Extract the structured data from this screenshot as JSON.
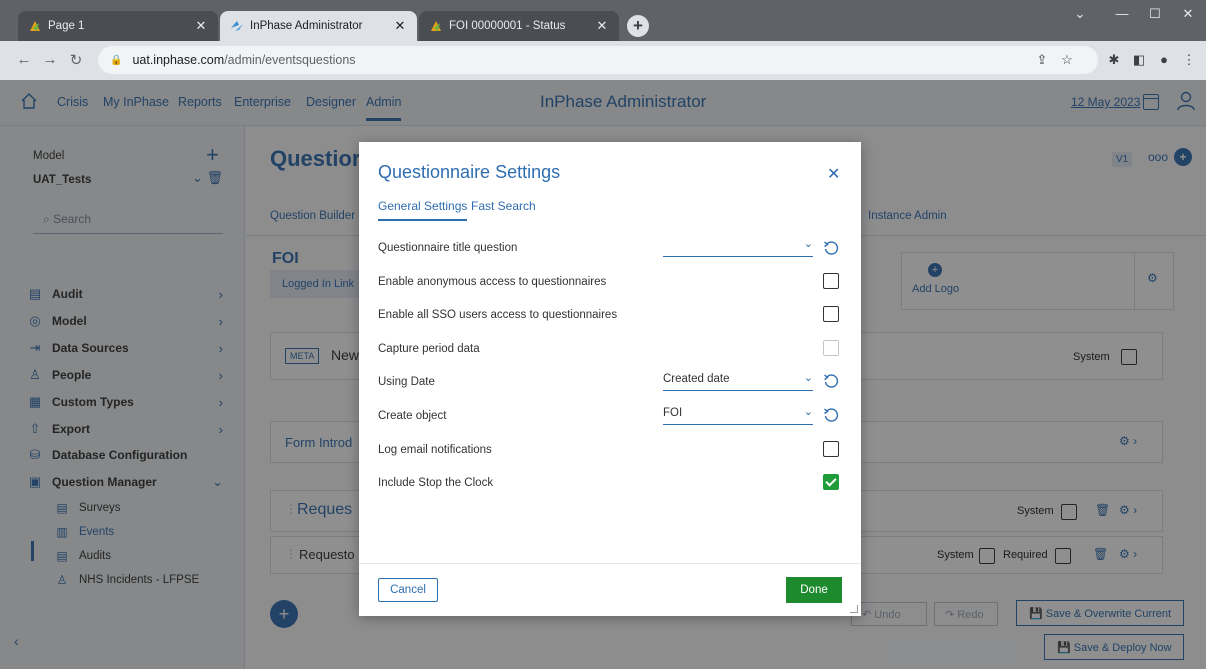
{
  "browser": {
    "tabs": [
      {
        "title": "Page 1",
        "active": false
      },
      {
        "title": "InPhase Administrator",
        "active": true
      },
      {
        "title": "FOI 00000001 - Status",
        "active": false
      }
    ],
    "url_host": "uat.inphase.com",
    "url_path": "/admin/eventsquestions"
  },
  "app": {
    "nav": [
      "Crisis",
      "My InPhase",
      "Reports",
      "Enterprise",
      "Designer",
      "Admin"
    ],
    "active_nav": "Admin",
    "title": "InPhase Administrator",
    "date": "12 May 2023"
  },
  "sidebar": {
    "model_label": "Model",
    "model_value": "UAT_Tests",
    "search_placeholder": "Search",
    "items": [
      {
        "label": "Audit",
        "icon": "audit-icon"
      },
      {
        "label": "Model",
        "icon": "model-icon"
      },
      {
        "label": "Data Sources",
        "icon": "data-sources-icon"
      },
      {
        "label": "People",
        "icon": "people-icon"
      },
      {
        "label": "Custom Types",
        "icon": "custom-types-icon"
      },
      {
        "label": "Export",
        "icon": "export-icon"
      },
      {
        "label": "Database Configuration",
        "icon": "database-icon"
      },
      {
        "label": "Question Manager",
        "icon": "question-manager-icon"
      }
    ],
    "subitems": [
      {
        "label": "Surveys",
        "icon": "surveys-icon"
      },
      {
        "label": "Events",
        "icon": "events-icon",
        "active": true
      },
      {
        "label": "Audits",
        "icon": "audits-icon"
      },
      {
        "label": "NHS Incidents - LFPSE",
        "icon": "nhs-incidents-icon"
      }
    ]
  },
  "main": {
    "title": "Questior",
    "version": "V1",
    "subtabs": [
      "Question Builder",
      "Instance Admin"
    ],
    "form_name": "FOI",
    "logged_in_link": "Logged In Link",
    "add_logo": "Add Logo",
    "meta_badge": "META",
    "meta_text": "New",
    "system_label": "System",
    "required_label": "Required",
    "form_intro": "Form Introd",
    "section_title": "Reques",
    "question_label": "Requesto",
    "undo": "Undo",
    "redo": "Redo",
    "save_overwrite": "Save & Overwrite Current",
    "save_deploy": "Save & Deploy Now"
  },
  "modal": {
    "title": "Questionnaire Settings",
    "tabs": [
      "General Settings",
      "Fast Search"
    ],
    "rows": [
      {
        "label": "Questionnaire title question",
        "control": "select",
        "value": ""
      },
      {
        "label": "Enable anonymous access to questionnaires",
        "control": "checkbox",
        "checked": false
      },
      {
        "label": "Enable all SSO users access to questionnaires",
        "control": "checkbox",
        "checked": false
      },
      {
        "label": "Capture period data",
        "control": "checkbox",
        "checked": false,
        "disabled": true
      },
      {
        "label": "Using Date",
        "control": "select",
        "value": "Created date"
      },
      {
        "label": "Create object",
        "control": "select",
        "value": "FOI"
      },
      {
        "label": "Log email notifications",
        "control": "checkbox",
        "checked": false
      },
      {
        "label": "Include Stop the Clock",
        "control": "checkbox",
        "checked": true
      }
    ],
    "cancel": "Cancel",
    "done": "Done"
  },
  "colors": {
    "accent": "#2f6db1",
    "done": "#1e8a2e",
    "checked": "#1f9d3a"
  }
}
